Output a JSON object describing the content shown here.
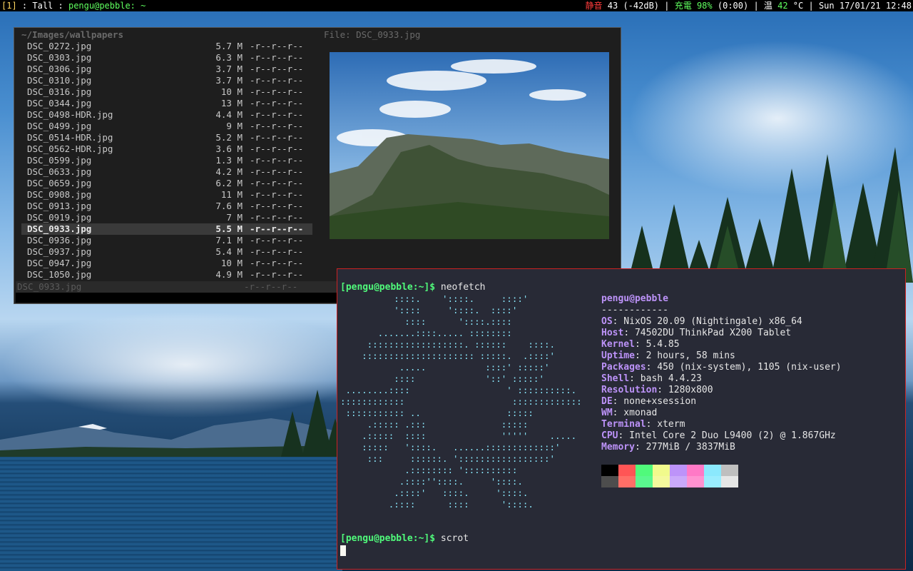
{
  "statusbar": {
    "workspace": "[1]",
    "sep1": " : ",
    "layout": "Tall",
    "sep2": " : ",
    "window_title": "pengu@pebble: ~",
    "mute_label": "静音",
    "volume": " 43 (-42dB) ",
    "bar1": "|",
    "charge_label": " 充電 ",
    "battery": "98%",
    "battery_time": " (0:00) ",
    "bar2": "|",
    "temp_label": " 温 ",
    "temp": "42",
    "temp_unit": " °C ",
    "bar3": "|",
    "datetime": " Sun 17/01/21 12:48"
  },
  "file_manager": {
    "path": "~/Images/wallpapers",
    "preview_title": "File: DSC_0933.jpg",
    "files": [
      {
        "name": "DSC_0272.jpg",
        "size": "5.7 M",
        "perm": "-r--r--r--"
      },
      {
        "name": "DSC_0303.jpg",
        "size": "6.3 M",
        "perm": "-r--r--r--"
      },
      {
        "name": "DSC_0306.jpg",
        "size": "3.7 M",
        "perm": "-r--r--r--"
      },
      {
        "name": "DSC_0310.jpg",
        "size": "3.7 M",
        "perm": "-r--r--r--"
      },
      {
        "name": "DSC_0316.jpg",
        "size": "10 M",
        "perm": "-r--r--r--"
      },
      {
        "name": "DSC_0344.jpg",
        "size": "13 M",
        "perm": "-r--r--r--"
      },
      {
        "name": "DSC_0498-HDR.jpg",
        "size": "4.4 M",
        "perm": "-r--r--r--"
      },
      {
        "name": "DSC_0499.jpg",
        "size": "9 M",
        "perm": "-r--r--r--"
      },
      {
        "name": "DSC_0514-HDR.jpg",
        "size": "5.2 M",
        "perm": "-r--r--r--"
      },
      {
        "name": "DSC_0562-HDR.jpg",
        "size": "3.6 M",
        "perm": "-r--r--r--"
      },
      {
        "name": "DSC_0599.jpg",
        "size": "1.3 M",
        "perm": "-r--r--r--"
      },
      {
        "name": "DSC_0633.jpg",
        "size": "4.2 M",
        "perm": "-r--r--r--"
      },
      {
        "name": "DSC_0659.jpg",
        "size": "6.2 M",
        "perm": "-r--r--r--"
      },
      {
        "name": "DSC_0908.jpg",
        "size": "11 M",
        "perm": "-r--r--r--"
      },
      {
        "name": "DSC_0913.jpg",
        "size": "7.6 M",
        "perm": "-r--r--r--"
      },
      {
        "name": "DSC_0919.jpg",
        "size": "7 M",
        "perm": "-r--r--r--"
      },
      {
        "name": "DSC_0933.jpg",
        "size": "5.5 M",
        "perm": "-r--r--r--",
        "selected": true
      },
      {
        "name": "DSC_0936.jpg",
        "size": "7.1 M",
        "perm": "-r--r--r--"
      },
      {
        "name": "DSC_0937.jpg",
        "size": "5.4 M",
        "perm": "-r--r--r--"
      },
      {
        "name": "DSC_0947.jpg",
        "size": "10 M",
        "perm": "-r--r--r--"
      },
      {
        "name": "DSC_1050.jpg",
        "size": "4.9 M",
        "perm": "-r--r--r--"
      }
    ],
    "footer_name": "DSC_0933.jpg",
    "footer_perm": "-r--r--r--"
  },
  "terminal": {
    "prompt": "[pengu@pebble:~]$",
    "command1": " neofetch",
    "command2": " scrot",
    "ascii_art": "          ::::.    '::::.     ::::'\n          '::::     '::::.  ::::'\n            ::::      '::::.::::\n       .......::::..... ::::::::\n     ::::::::::::::::::. ::::::    ::::.\n    ::::::::::::::::::::: :::::.  .::::'\n           .....           ::::' :::::'\n          ::::             '::' :::::'\n ........::::                  ' ::::::::::.\n::::::::::::                    :::::::::::::\n ::::::::::: ..                :::::\n     .::::: .:::              :::::\n    .:::::  ::::              '''''    .....\n    :::::   '::::.   ......:::::::::::::'\n     :::     ::::::. ':::::::::::::::::'\n            .:::::::: '::::::::::\n           .::::''::::.     '::::.\n          .::::'   ::::.     '::::.\n         .::::      ::::      '::::.",
    "info_user": "pengu@pebble",
    "info_sep": "------------",
    "info": [
      {
        "key": "OS",
        "value": ": NixOS 20.09 (Nightingale) x86_64"
      },
      {
        "key": "Host",
        "value": ": 74502DU ThinkPad X200 Tablet"
      },
      {
        "key": "Kernel",
        "value": ": 5.4.85"
      },
      {
        "key": "Uptime",
        "value": ": 2 hours, 58 mins"
      },
      {
        "key": "Packages",
        "value": ": 450 (nix-system), 1105 (nix-user)"
      },
      {
        "key": "Shell",
        "value": ": bash 4.4.23"
      },
      {
        "key": "Resolution",
        "value": ": 1280x800"
      },
      {
        "key": "DE",
        "value": ": none+xsession"
      },
      {
        "key": "WM",
        "value": ": xmonad"
      },
      {
        "key": "Terminal",
        "value": ": xterm"
      },
      {
        "key": "CPU",
        "value": ": Intel Core 2 Duo L9400 (2) @ 1.867GHz"
      },
      {
        "key": "Memory",
        "value": ": 277MiB / 3837MiB"
      }
    ],
    "palette_top": [
      "#000000",
      "#ff5555",
      "#50fa7b",
      "#f1fa8c",
      "#bd93f9",
      "#ff79c6",
      "#8be9fd",
      "#bfbfbf"
    ],
    "palette_bottom": [
      "#4d4d4d",
      "#ff6e67",
      "#5af78e",
      "#f4f99d",
      "#caa9fa",
      "#ff92d0",
      "#9aedfe",
      "#e6e6e6"
    ]
  }
}
